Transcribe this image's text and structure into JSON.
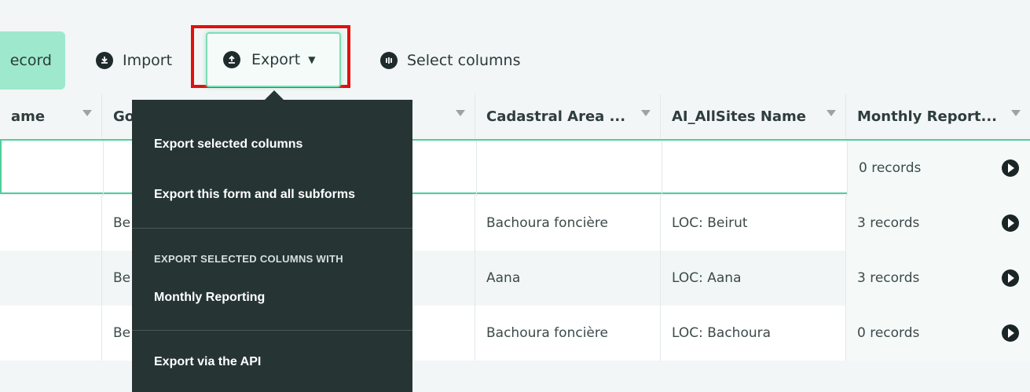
{
  "toolbar": {
    "add_label": "ecord",
    "import_label": "Import",
    "export_label": "Export",
    "select_columns_label": "Select columns"
  },
  "table": {
    "headers": [
      "ame",
      "Go",
      "Cadastral Area ...",
      "AI_AllSites Name",
      "Monthly Report..."
    ],
    "rows": [
      {
        "gov": "",
        "cadastral": "",
        "site": "",
        "monthly": "0 records"
      },
      {
        "gov": "Be",
        "cadastral": "Bachoura foncière",
        "site": "LOC: Beirut",
        "monthly": "3 records"
      },
      {
        "gov": "Be",
        "cadastral": "Aana",
        "site": "LOC: Aana",
        "monthly": "3 records"
      },
      {
        "gov": "Be",
        "cadastral": "Bachoura foncière",
        "site": "LOC: Bachoura",
        "monthly": "0 records"
      }
    ]
  },
  "export_menu": {
    "item1": "Export selected columns",
    "item2": "Export this form and all subforms",
    "section_header": "EXPORT SELECTED COLUMNS WITH",
    "item3": "Monthly Reporting",
    "item4": "Export via the API"
  },
  "colors": {
    "accent": "#9ee9cd",
    "highlight_border": "#e0100f",
    "menu_bg": "#263434"
  }
}
